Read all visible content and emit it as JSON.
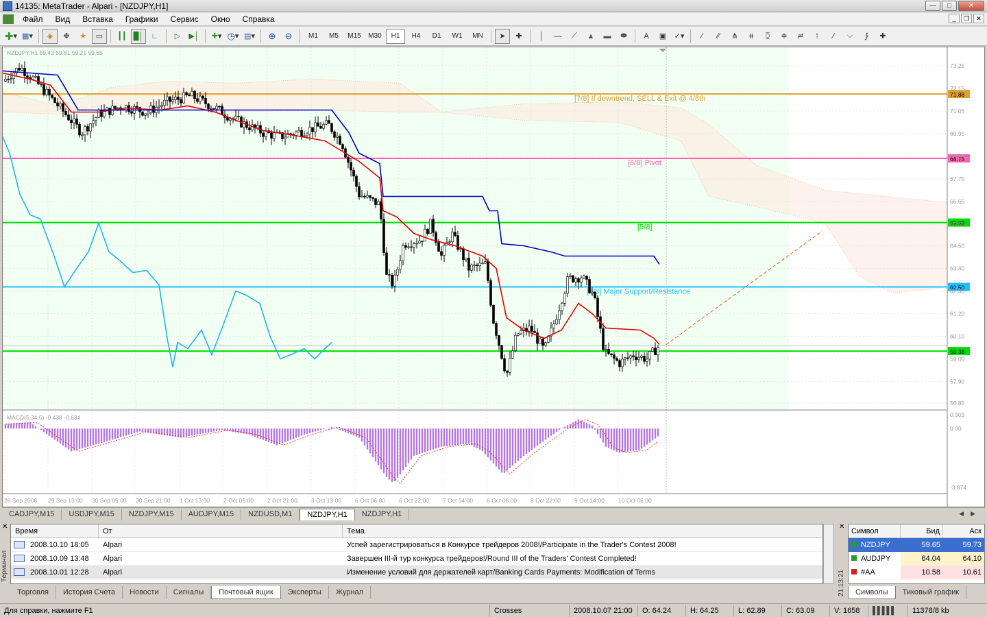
{
  "window": {
    "title": "14135: MetaTrader - Alpari - [NZDJPY,H1]"
  },
  "menu": [
    "Файл",
    "Вид",
    "Вставка",
    "Графики",
    "Сервис",
    "Окно",
    "Справка"
  ],
  "toolbar": {
    "timeframes": [
      "M1",
      "M5",
      "M15",
      "M30",
      "H1",
      "H4",
      "D1",
      "W1",
      "MN"
    ],
    "active_timeframe": "H1"
  },
  "chart": {
    "header": "NZDJPY,H1  59.43 59.81 59.21 59.65",
    "macd_label": "MACD(5,34,5) -0.438 -0.634",
    "price_ticks": [
      "73.25",
      "72.15",
      "71.05",
      "69.95",
      "68.85",
      "67.75",
      "66.65",
      "65.55",
      "64.50",
      "63.40",
      "62.30",
      "61.20",
      "60.10",
      "59.00",
      "57.90",
      "56.85"
    ],
    "macd_ticks": [
      "0.903",
      "0.00",
      "-3.874"
    ],
    "time_ticks": [
      "26 Sep 2008",
      "29 Sep 13:00",
      "30 Sep 05:00",
      "30 Sep 21:00",
      "1 Oct 13:00",
      "2 Oct 05:00",
      "2 Oct 21:00",
      "3 Oct 13:00",
      "6 Oct 06:00",
      "6 Oct 22:00",
      "7 Oct 14:00",
      "8 Oct 06:00",
      "8 Oct 22:00",
      "9 Oct 14:00",
      "10 Oct 06:00"
    ],
    "levels": [
      {
        "label": "[7/8] If downtrend, SELL & Exit @ 4/8th",
        "price": "71.88",
        "color": "#e0a030"
      },
      {
        "label": "[6/8] Pivot",
        "price": "68.75",
        "color": "#ff60b0"
      },
      {
        "label": "[5/8]",
        "price": "65.63",
        "color": "#00dd00"
      },
      {
        "label": "[4/8] Major Support/Resistance",
        "price": "62.50",
        "color": "#20c0ff"
      },
      {
        "label": "",
        "price": "59.38",
        "color": "#00dd00"
      }
    ],
    "current_price": "59.65"
  },
  "chart_tabs": [
    "CADJPY,M15",
    "USDJPY,M15",
    "NZDJPY,M15",
    "AUDJPY,M15",
    "NZDUSD,M1",
    "NZDJPY,H1",
    "NZDJPY,H1"
  ],
  "active_chart_tab": 5,
  "terminal": {
    "label": "Терминал",
    "columns": [
      "Время",
      "От",
      "Тема"
    ],
    "rows": [
      {
        "time": "2008.10.10 18:05",
        "from": "Alpari",
        "subject": "Успей зарегистрироваться в Конкурсе трейдеров 2008!/Participate in the Trader's Contest 2008!"
      },
      {
        "time": "2008.10.09 13:48",
        "from": "Alpari",
        "subject": "Завершен III-й тур конкурса трейдеров!/Round III of the Traders' Contest Completed!"
      },
      {
        "time": "2008.10.01 12:28",
        "from": "Alpari",
        "subject": "Изменение условий для держателей карт/Banking Cards Payments: Modification of Terms"
      }
    ],
    "tabs": [
      "Торговля",
      "История Счета",
      "Новости",
      "Сигналы",
      "Почтовый ящик",
      "Эксперты",
      "Журнал"
    ],
    "active_tab": 4
  },
  "market_watch": {
    "time": "21:13:21",
    "columns": [
      "Символ",
      "Бид",
      "Аск"
    ],
    "rows": [
      {
        "symbol": "NZDJPY",
        "bid": "59.65",
        "ask": "59.73"
      },
      {
        "symbol": "AUDJPY",
        "bid": "64.04",
        "ask": "64.10"
      },
      {
        "symbol": "#AA",
        "bid": "10.58",
        "ask": "10.61"
      }
    ],
    "tabs": [
      "Символы",
      "Тиковый график"
    ]
  },
  "status": {
    "help": "Для справки, нажмите F1",
    "profile": "Crosses",
    "datetime": "2008.10.07 21:00",
    "open": "O: 64.24",
    "high": "H: 64.25",
    "low": "L: 62.89",
    "close": "C: 63.09",
    "volume": "V: 1658",
    "traffic": "11378/8 kb"
  }
}
